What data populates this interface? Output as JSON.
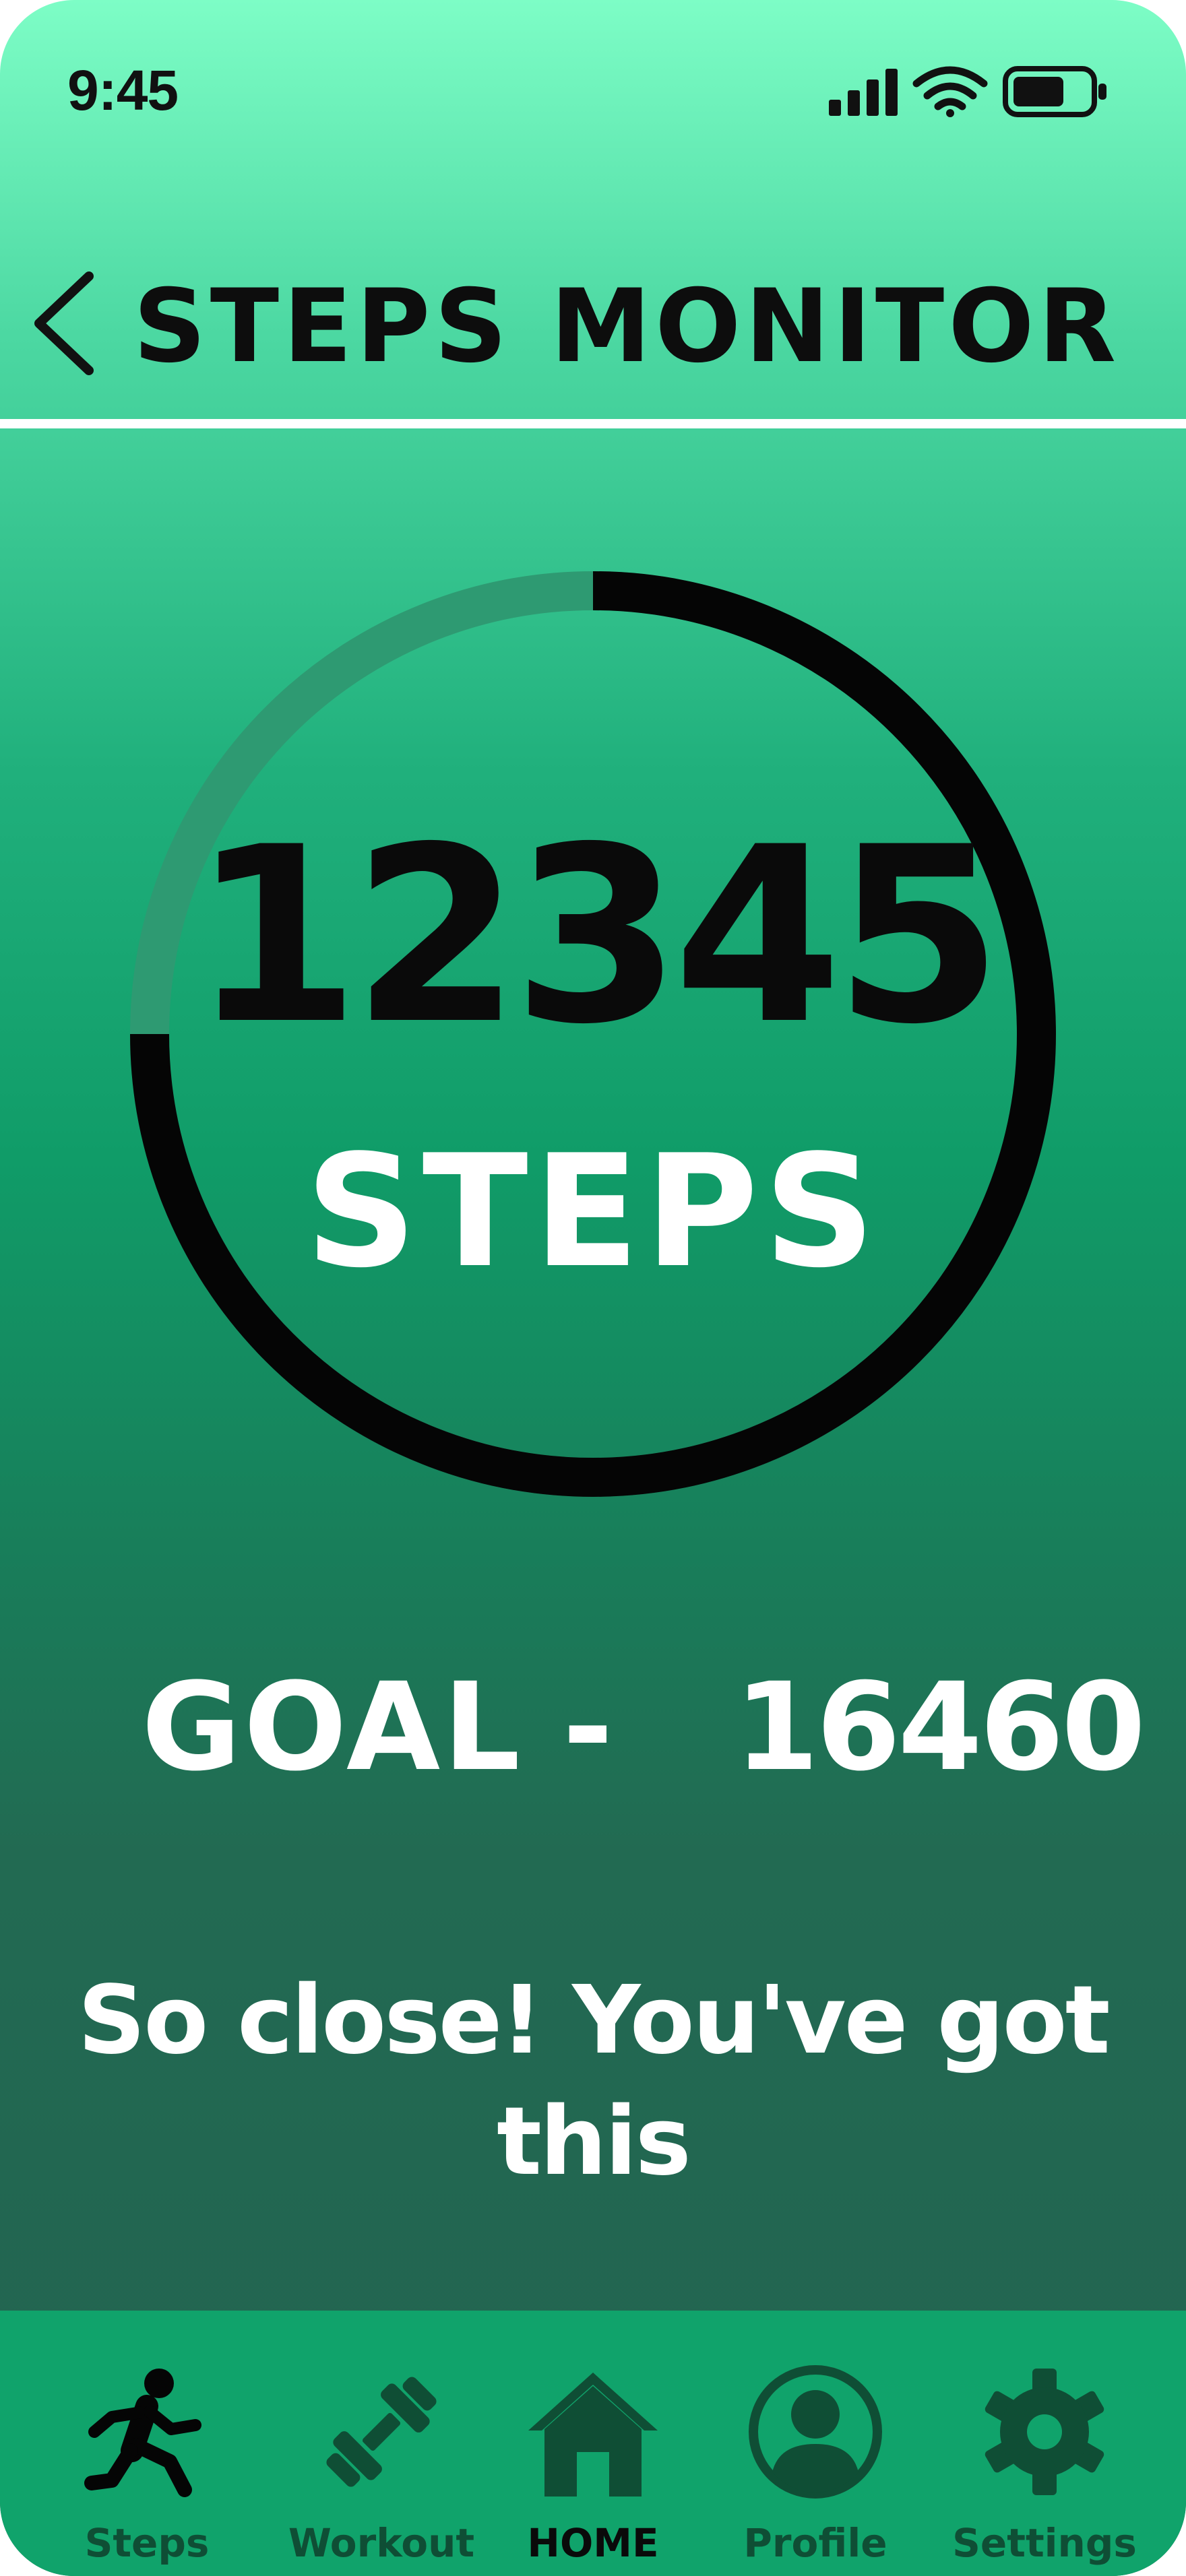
{
  "status_bar": {
    "time": "9:45",
    "icons": [
      "cellular-signal-icon",
      "wifi-icon",
      "battery-icon"
    ]
  },
  "header": {
    "back_icon": "chevron-left-icon",
    "title": "STEPS MONITOR"
  },
  "progress": {
    "steps": "12345",
    "unit_label": "STEPS",
    "goal_fraction": 0.75
  },
  "goal": {
    "label": "GOAL",
    "separator": "-",
    "value": "16460"
  },
  "motivation": "So close! You've got this",
  "bottom_nav": {
    "items": [
      {
        "label": "Steps",
        "icon": "running-person-icon",
        "active": false
      },
      {
        "label": "Workout",
        "icon": "dumbbell-icon",
        "active": false
      },
      {
        "label": "HOME",
        "icon": "home-icon",
        "active": true
      },
      {
        "label": "Profile",
        "icon": "profile-icon",
        "active": false
      },
      {
        "label": "Settings",
        "icon": "gear-icon",
        "active": false
      }
    ]
  },
  "colors": {
    "gradient_top": "#7dfdc6",
    "gradient_mid": "#109c68",
    "gradient_bottom": "#236350",
    "ring_progress": "#050505",
    "ring_track": "#2e9a72",
    "nav_background": "#10a36b",
    "nav_icon": "#0f4e35",
    "text_light": "#ffffff",
    "text_dark": "#0d0d0d"
  }
}
